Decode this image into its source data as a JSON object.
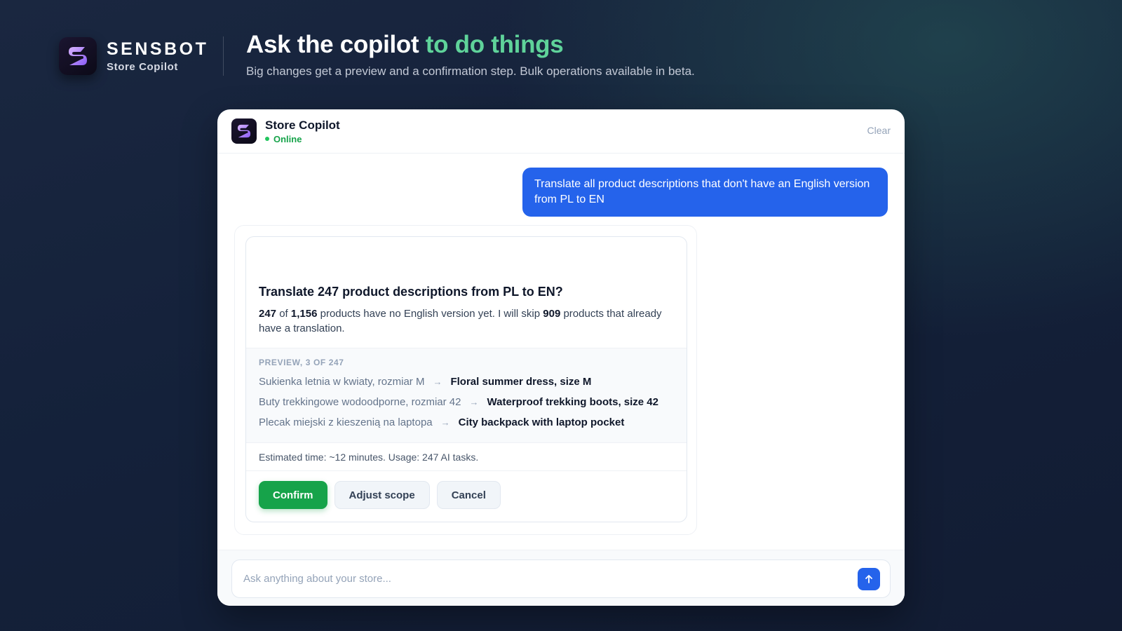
{
  "brand": {
    "name": "SENSBOT",
    "subtitle": "Store Copilot",
    "logo_icon": "s-logo-icon"
  },
  "hero": {
    "title_main": "Ask the copilot ",
    "title_accent": "to do things",
    "subtitle": "Big changes get a preview and a confirmation step. Bulk operations available in beta."
  },
  "chat": {
    "title": "Store Copilot",
    "status": "Online",
    "clear_label": "Clear",
    "user_message": "Translate all product descriptions that don't have an English version from PL to EN",
    "confirmation": {
      "title": "Translate 247 product descriptions from PL to EN?",
      "desc": {
        "count": "247",
        "of": "of",
        "total": "1,156",
        "middle": "products have no English version yet. I will skip",
        "skip": "909",
        "end": "products that already have a translation."
      },
      "preview_label": "PREVIEW, 3 OF 247",
      "preview_rows": [
        {
          "src": "Sukienka letnia w kwiaty, rozmiar M",
          "dst": "Floral summer dress, size M"
        },
        {
          "src": "Buty trekkingowe wodoodporne, rozmiar 42",
          "dst": "Waterproof trekking boots, size 42"
        },
        {
          "src": "Plecak miejski z kieszenią na laptopa",
          "dst": "City backpack with laptop pocket"
        }
      ],
      "arrow": "→",
      "estimate": "Estimated time: ~12 minutes. Usage: 247 AI tasks.",
      "buttons": {
        "confirm": "Confirm",
        "adjust": "Adjust scope",
        "cancel": "Cancel"
      }
    },
    "composer": {
      "placeholder": "Ask anything about your store...",
      "value": ""
    }
  },
  "colors": {
    "accent_green": "#5fd39a",
    "user_bubble": "#2563eb",
    "confirm": "#16a34a",
    "online": "#22c55e"
  }
}
